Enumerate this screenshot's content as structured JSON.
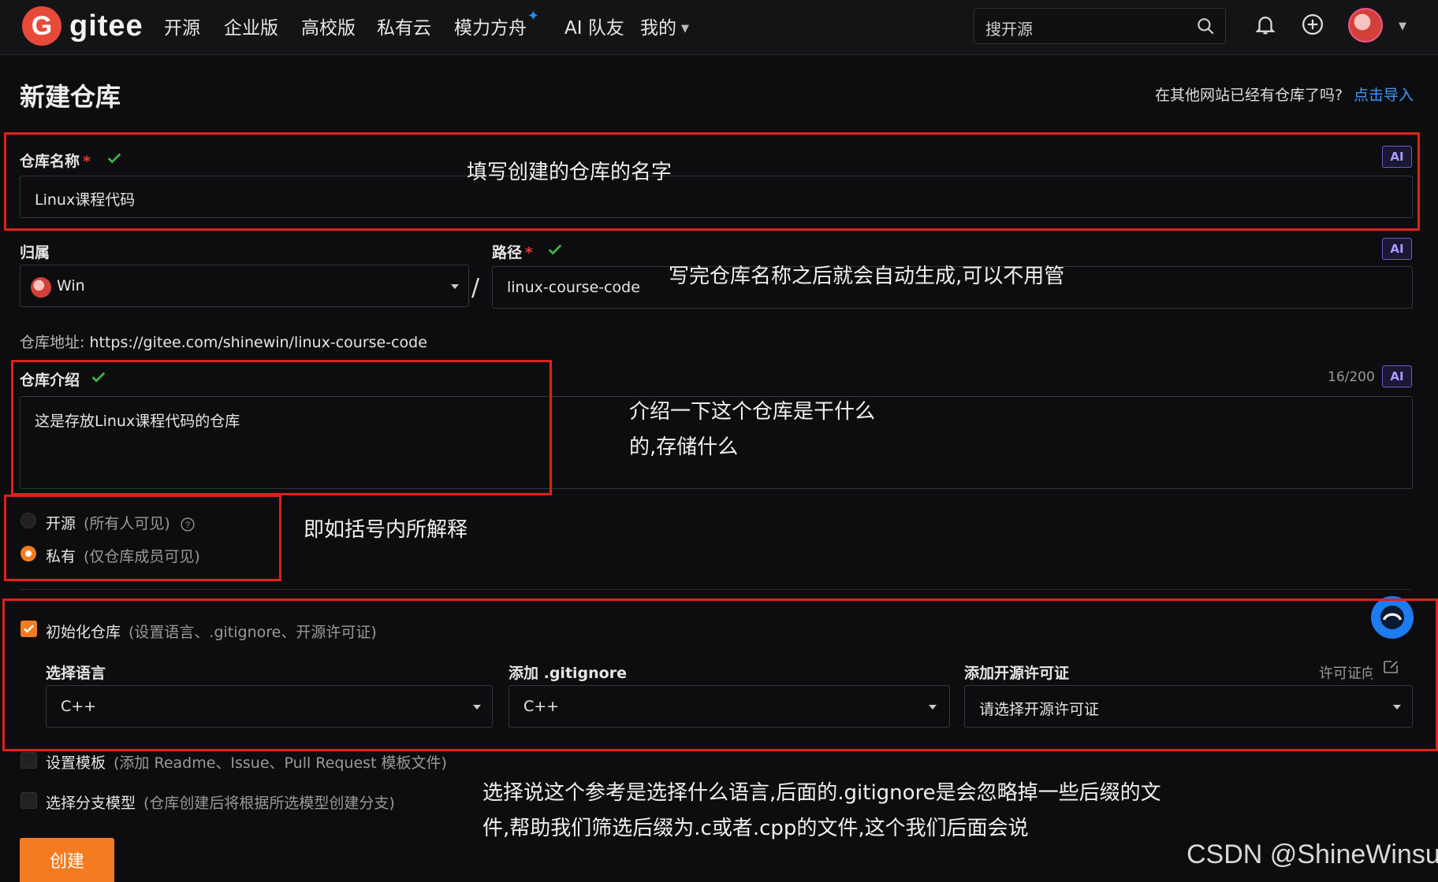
{
  "nav": {
    "logo_letter": "G",
    "logo_text": "gitee",
    "items": [
      "开源",
      "企业版",
      "高校版",
      "私有云",
      "模力方舟",
      "AI 队友",
      "我的"
    ],
    "search_placeholder": "搜开源",
    "icons": [
      "search-icon",
      "bell-icon",
      "plus-circle-icon",
      "avatar",
      "chevron-down-icon"
    ]
  },
  "header": {
    "title": "新建仓库",
    "import_question": "在其他网站已经有仓库了吗?",
    "import_link": "点击导入"
  },
  "form": {
    "repo_name": {
      "label": "仓库名称",
      "required": "*",
      "value": "Linux课程代码",
      "ai": "AI"
    },
    "owner": {
      "label": "归属",
      "value": "Win"
    },
    "separator": "/",
    "path": {
      "label": "路径",
      "required": "*",
      "value": "linux-course-code",
      "ai": "AI"
    },
    "repo_url": {
      "label": "仓库地址:",
      "value": "https://gitee.com/shinewin/linux-course-code"
    },
    "description": {
      "label": "仓库介绍",
      "value": "这是存放Linux课程代码的仓库",
      "counter": "16/200",
      "ai": "AI"
    },
    "visibility": [
      {
        "label": "开源",
        "hint": "(所有人可见)",
        "selected": false
      },
      {
        "label": "私有",
        "hint": "(仅仓库成员可见)",
        "selected": true
      }
    ],
    "init_repo": {
      "label": "初始化仓库",
      "hint": "(设置语言、.gitignore、开源许可证)",
      "checked": true
    },
    "language": {
      "label": "选择语言",
      "value": "C++"
    },
    "gitignore": {
      "label": "添加 .gitignore",
      "value": "C++"
    },
    "license": {
      "label": "添加开源许可证",
      "value": "请选择开源许可证",
      "side_label": "许可证向"
    },
    "template": {
      "label": "设置模板",
      "hint": "(添加 Readme、Issue、Pull Request 模板文件)",
      "checked": false
    },
    "branch_model": {
      "label": "选择分支模型",
      "hint": "(仓库创建后将根据所选模型创建分支)",
      "checked": false
    },
    "create_button": "创建"
  },
  "annotations": {
    "name": "填写创建的仓库的名字",
    "path": "写完仓库名称之后就会自动生成,可以不用管",
    "desc_line1": "介绍一下这个仓库是干什么",
    "desc_line2": "的,存储什么",
    "visibility": "即如括号内所解释",
    "init_line1": "选择说这个参考是选择什么语言,后面的.gitignore是会忽略掉一些后缀的文",
    "init_line2": "件,帮助我们筛选后缀为.c或者.cpp的文件,这个我们后面会说"
  },
  "watermark": "CSDN @ShineWinsu",
  "colors": {
    "accent": "#f47b20",
    "annotation_border": "#e0211a",
    "link": "#3b9bff",
    "check": "#3fb24a"
  }
}
